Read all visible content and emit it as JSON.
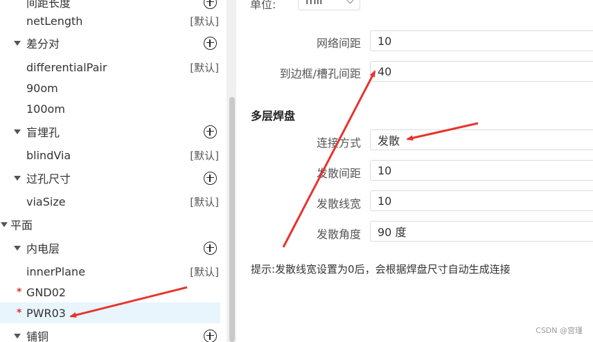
{
  "tree": {
    "top_cut": "间距长度",
    "net_length": "netLength",
    "default_tag": "[默认]",
    "diff_pair": "差分对",
    "differential_pair": "differentialPair",
    "ohm90": "90om",
    "ohm100": "100om",
    "blind_buried": "盲埋孔",
    "blind_via": "blindVia",
    "via_size_group": "过孔尺寸",
    "via_size": "viaSize",
    "plane": "平面",
    "inner_layer": "内电层",
    "inner_plane": "innerPlane",
    "gnd02": "GND02",
    "pwr03": "PWR03",
    "copper": "铺铜",
    "required_mark": "*"
  },
  "form": {
    "unit_label": "单位:",
    "unit_value": "mil",
    "net_spacing_label": "网络间距",
    "net_spacing_value": "10",
    "edge_spacing_label": "到边框/槽孔间距",
    "edge_spacing_value": "40",
    "multilayer_title": "多层焊盘",
    "connect_label": "连接方式",
    "connect_value": "发散",
    "spoke_gap_label": "发散间距",
    "spoke_gap_value": "10",
    "spoke_width_label": "发散线宽",
    "spoke_width_value": "10",
    "spoke_angle_label": "发散角度",
    "spoke_angle_value": "90 度",
    "tip": "提示:发散线宽设置为0后，会根据焊盘尺寸自动生成连接"
  },
  "watermark": "CSDN @宫瑾",
  "colors": {
    "arrow": "#e8322c",
    "selected_bg": "#e9f5fd",
    "required": "#e0302a"
  }
}
